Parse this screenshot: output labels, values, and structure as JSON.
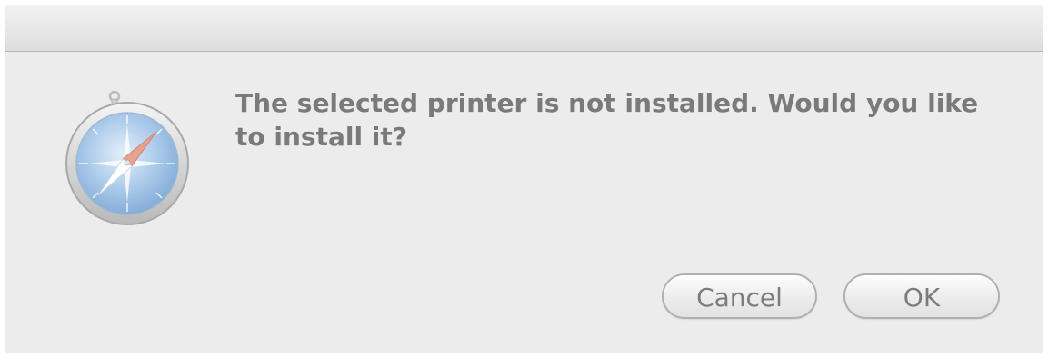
{
  "dialog": {
    "message": "The selected printer is not installed. Would you like to install it?",
    "icon": "safari-compass-icon",
    "buttons": {
      "cancel_label": "Cancel",
      "ok_label": "OK"
    }
  },
  "colors": {
    "dialog_bg": "#ececec",
    "text": "#7a7a7a",
    "icon_blue": "#8db7dd",
    "needle_red": "#e8a090"
  }
}
